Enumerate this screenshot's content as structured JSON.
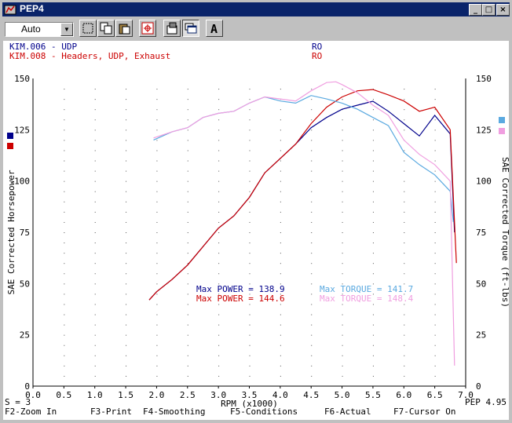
{
  "window": {
    "title": "PEP4"
  },
  "toolbar": {
    "zoom_value": "Auto"
  },
  "legend": [
    {
      "file": "KIM.006 - UDP",
      "tag": "RO",
      "color": "#00008b"
    },
    {
      "file": "KIM.008 - Headers, UDP, Exhaust",
      "tag": "RO",
      "color": "#cc0000"
    }
  ],
  "colors": {
    "power_1": "#00008b",
    "power_2": "#cc0000",
    "torque_1": "#5aa9e0",
    "torque_2": "#f09ee0"
  },
  "max_labels": [
    {
      "label": "Max POWER = 138.9",
      "color": "#00008b"
    },
    {
      "label": "Max POWER = 144.6",
      "color": "#cc0000"
    },
    {
      "label": "Max TORQUE = 141.7",
      "color": "#5aa9e0"
    },
    {
      "label": "Max TORQUE = 148.4",
      "color": "#f09ee0"
    }
  ],
  "status": {
    "smoothing": "S = 3",
    "version": "PEP 4.95"
  },
  "function_keys": [
    "F2-Zoom In",
    "F3-Print",
    "F4-Smoothing",
    "F5-Conditions",
    "F6-Actual",
    "F7-Cursor On"
  ],
  "chart_data": {
    "type": "line",
    "xlabel": "RPM (x1000)",
    "ylabel": "SAE Corrected Horsepower",
    "y2label": "SAE Corrected Torque (ft-lbs)",
    "xlim": [
      0,
      7.0
    ],
    "ylim": [
      0,
      150
    ],
    "xticks": [
      "0.0",
      "0.5",
      "1.0",
      "1.5",
      "2.0",
      "2.5",
      "3.0",
      "3.5",
      "4.0",
      "4.5",
      "5.0",
      "5.5",
      "6.0",
      "6.5",
      "7.0"
    ],
    "yticks": [
      "0",
      "25",
      "50",
      "75",
      "100",
      "125",
      "150"
    ],
    "grid": true,
    "series": [
      {
        "name": "KIM.006 - UDP",
        "quantity": "power",
        "color": "#00008b",
        "x": [
          1.88,
          2.0,
          2.25,
          2.5,
          2.75,
          3.0,
          3.25,
          3.5,
          3.75,
          4.0,
          4.25,
          4.5,
          4.75,
          5.0,
          5.25,
          5.5,
          5.75,
          6.0,
          6.25,
          6.5,
          6.75,
          6.82
        ],
        "y": [
          42,
          46,
          52,
          59,
          68,
          77,
          83,
          92,
          104,
          111,
          118,
          126,
          131,
          135,
          137,
          138.9,
          134,
          128,
          122,
          132,
          123,
          75
        ]
      },
      {
        "name": "KIM.008 - Headers, UDP, Exhaust",
        "quantity": "power",
        "color": "#cc0000",
        "x": [
          1.88,
          2.0,
          2.25,
          2.5,
          2.75,
          3.0,
          3.25,
          3.5,
          3.75,
          4.0,
          4.25,
          4.5,
          4.75,
          5.0,
          5.25,
          5.5,
          5.75,
          6.0,
          6.25,
          6.5,
          6.75,
          6.85
        ],
        "y": [
          42,
          46,
          52,
          59,
          68,
          77,
          83,
          92,
          104,
          111,
          118,
          128,
          136,
          141,
          144,
          144.6,
          142,
          139,
          134,
          136,
          125,
          60
        ]
      },
      {
        "name": "KIM.006 - UDP",
        "quantity": "torque",
        "color": "#5aa9e0",
        "x": [
          1.95,
          2.25,
          2.5,
          2.75,
          3.0,
          3.25,
          3.5,
          3.75,
          4.0,
          4.25,
          4.5,
          4.75,
          5.0,
          5.25,
          5.5,
          5.75,
          6.0,
          6.25,
          6.5,
          6.75,
          6.8
        ],
        "y": [
          120,
          124,
          126,
          131,
          133,
          134,
          138,
          141,
          139,
          138,
          141.7,
          140,
          138,
          135,
          131,
          127,
          114,
          108,
          103,
          95,
          80
        ]
      },
      {
        "name": "KIM.008 - Headers, UDP, Exhaust",
        "quantity": "torque",
        "color": "#f09ee0",
        "x": [
          1.95,
          2.25,
          2.5,
          2.75,
          3.0,
          3.25,
          3.5,
          3.75,
          4.0,
          4.25,
          4.5,
          4.75,
          4.9,
          5.0,
          5.25,
          5.5,
          5.75,
          6.0,
          6.25,
          6.5,
          6.75,
          6.82
        ],
        "y": [
          121,
          124,
          126,
          131,
          133,
          134,
          138,
          141,
          140,
          139,
          144,
          148,
          148.4,
          147,
          143,
          137,
          132,
          120,
          113,
          108,
          100,
          10
        ]
      }
    ]
  }
}
